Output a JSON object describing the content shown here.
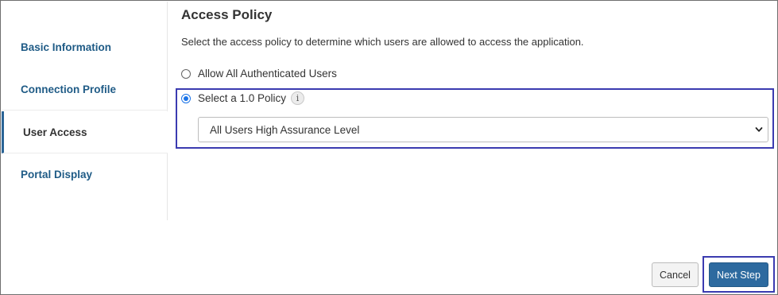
{
  "sidebar": {
    "items": [
      {
        "label": "Basic Information"
      },
      {
        "label": "Connection Profile"
      },
      {
        "label": "User Access"
      },
      {
        "label": "Portal Display"
      }
    ]
  },
  "main": {
    "title": "Access Policy",
    "description": "Select the access policy to determine which users are allowed to access the application.",
    "options": [
      {
        "label": "Allow All Authenticated Users",
        "selected": false
      },
      {
        "label": "Select a 1.0 Policy",
        "selected": true
      }
    ],
    "info_icon_glyph": "i",
    "policy_select": {
      "value": "All Users High Assurance Level"
    }
  },
  "footer": {
    "cancel_label": "Cancel",
    "next_label": "Next Step"
  },
  "colors": {
    "link": "#1f5b86",
    "primary_button": "#2d6a9f",
    "highlight": "#3b3bb0",
    "radio_selected": "#1a73e8"
  }
}
